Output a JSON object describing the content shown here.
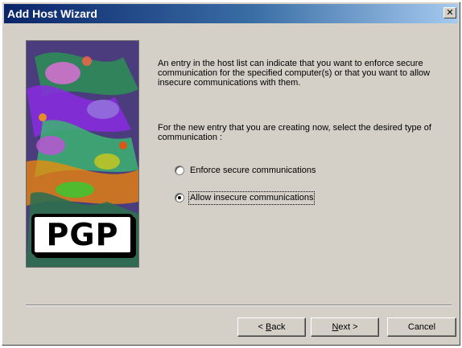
{
  "window": {
    "title": "Add Host Wizard",
    "close_glyph": "✕"
  },
  "banner": {
    "logo_text": "PGP"
  },
  "content": {
    "paragraph1": "An entry in the host list can indicate that you want to enforce secure communication for the specified computer(s) or that you want to allow insecure communications with them.",
    "paragraph2": "For the new entry that you are creating now, select the desired type of communication :"
  },
  "options": [
    {
      "label": "Enforce secure communications",
      "selected": false
    },
    {
      "label": "Allow insecure communications",
      "selected": true
    }
  ],
  "buttons": {
    "back_prefix": "< ",
    "back_key": "B",
    "back_rest": "ack",
    "next_key": "N",
    "next_rest": "ext >",
    "cancel": "Cancel"
  },
  "colors": {
    "titlebar_start": "#0a246a",
    "titlebar_end": "#a6caf0",
    "dialog_face": "#d4d0c8"
  }
}
